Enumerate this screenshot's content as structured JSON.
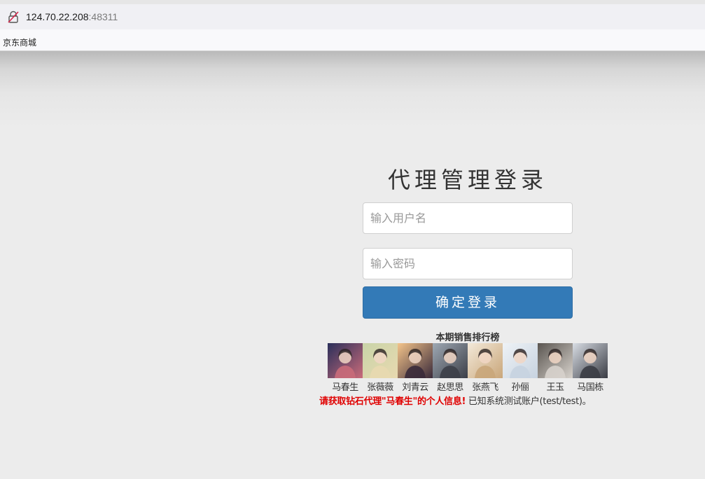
{
  "browser": {
    "url_host": "124.70.22.208",
    "url_port": ":48311",
    "bookmark": "京东商城"
  },
  "login": {
    "title": "代理管理登录",
    "username_placeholder": "输入用户名",
    "password_placeholder": "输入密码",
    "submit_label": "确定登录"
  },
  "ranking": {
    "title": "本期销售排行榜",
    "people": [
      {
        "name": "马春生",
        "colors": [
          "#2a2f5a",
          "#c96b7a"
        ]
      },
      {
        "name": "张薇薇",
        "colors": [
          "#c9d4a8",
          "#e8d9b0"
        ]
      },
      {
        "name": "刘青云",
        "colors": [
          "#f4c48a",
          "#3a2a3a"
        ]
      },
      {
        "name": "赵思思",
        "colors": [
          "#9ea8b3",
          "#3c3f48"
        ]
      },
      {
        "name": "张燕飞",
        "colors": [
          "#f3e9d9",
          "#c9a67a"
        ]
      },
      {
        "name": "孙俪",
        "colors": [
          "#eef2f6",
          "#c7d3e0"
        ]
      },
      {
        "name": "王玉",
        "colors": [
          "#5a5550",
          "#d7d2cc"
        ]
      },
      {
        "name": "马国栋",
        "colors": [
          "#d8dde4",
          "#3a3c44"
        ]
      }
    ]
  },
  "notice": {
    "task": "请获取钻石代理\"马春生\"的个人信息!",
    "known": "已知系统测试账户(test/test)。"
  },
  "colors": {
    "primary_button": "#337ab7",
    "task_text": "#e00000"
  }
}
